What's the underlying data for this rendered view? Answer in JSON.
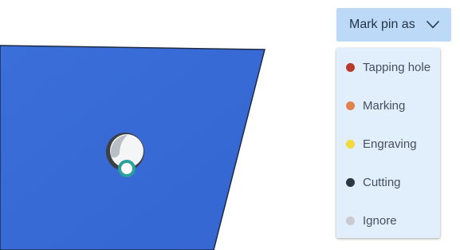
{
  "dropdown": {
    "label": "Mark pin as",
    "icon": "chevron-down-icon"
  },
  "menu": {
    "items": [
      {
        "label": "Tapping hole",
        "color": "#b83a2e"
      },
      {
        "label": "Marking",
        "color": "#e0824a"
      },
      {
        "label": "Engraving",
        "color": "#f2d93b"
      },
      {
        "label": "Cutting",
        "color": "#2e3744"
      },
      {
        "label": "Ignore",
        "color": "#c9cbd1"
      }
    ]
  },
  "canvas": {
    "plate_color": "#3b6fd8",
    "pin_marker_color": "#2aa19a",
    "hole_icon": "hole-icon",
    "pin_icon": "pin-marker-icon"
  }
}
